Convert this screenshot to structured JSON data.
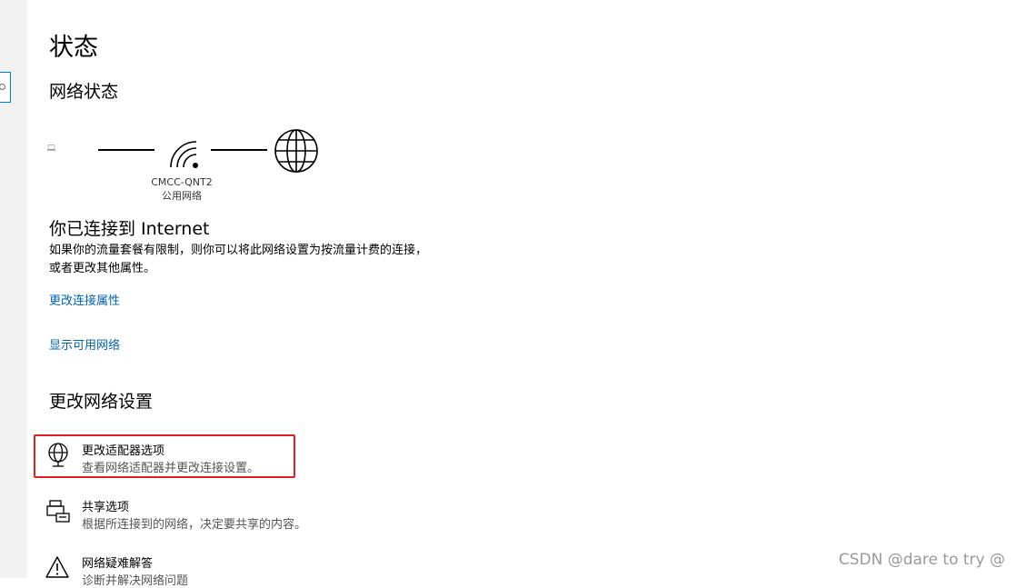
{
  "page": {
    "title": "状态"
  },
  "network_status": {
    "heading": "网络状态",
    "ssid": "CMCC-QNT2",
    "network_type": "公用网络",
    "connected_title": "你已连接到 Internet",
    "description": "如果你的流量套餐有限制，则你可以将此网络设置为按流量计费的连接，或者更改其他属性。",
    "links": {
      "properties": "更改连接属性",
      "available": "显示可用网络"
    }
  },
  "change_settings": {
    "heading": "更改网络设置",
    "options": [
      {
        "title": "更改适配器选项",
        "subtitle": "查看网络适配器并更改连接设置。",
        "icon": "adapter-globe-icon"
      },
      {
        "title": "共享选项",
        "subtitle": "根据所连接到的网络，决定要共享的内容。",
        "icon": "sharing-printer-icon"
      },
      {
        "title": "网络疑难解答",
        "subtitle": "诊断并解决网络问题",
        "icon": "warning-triangle-icon"
      }
    ]
  },
  "watermark": "CSDN @dare to try @",
  "colors": {
    "link": "#0063b1",
    "highlight_border": "#e02020",
    "search_border": "#0078d7"
  }
}
